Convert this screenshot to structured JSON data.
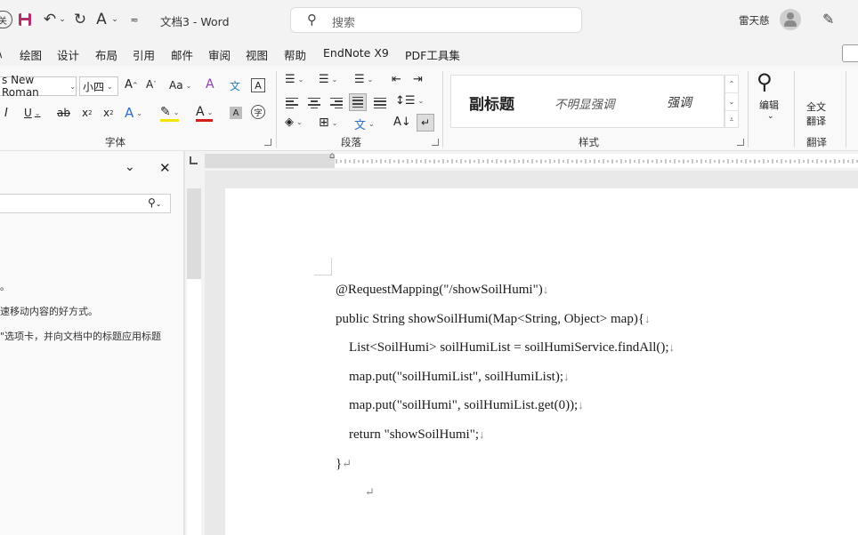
{
  "titlebar": {
    "doc_title": "文档3  -  Word",
    "search_placeholder": "搜索",
    "user_name": "雷天慈"
  },
  "menu": {
    "items": [
      "\\",
      "绘图",
      "设计",
      "布局",
      "引用",
      "邮件",
      "审阅",
      "视图",
      "帮助",
      "EndNote X9",
      "PDF工具集"
    ]
  },
  "ribbon": {
    "font_name": "s New Roman",
    "font_size": "小四",
    "groups": {
      "font": "字体",
      "paragraph": "段落",
      "styles": "样式",
      "translate": "翻译"
    },
    "styles": [
      "副标题",
      "不明显强调",
      "强调"
    ],
    "editing_label": "编辑",
    "fulltext_translate_line1": "全文",
    "fulltext_translate_line2": "翻译"
  },
  "nav_pane": {
    "line1": "。",
    "line2": "速移动内容的好方式。",
    "line3": "\"选项卡，并向文档中的标题应用标题"
  },
  "document": {
    "lines": [
      {
        "text": "@RequestMapping(\"/showSoilHumi\")",
        "mark": "↓"
      },
      {
        "text": "public String showSoilHumi(Map<String, Object> map){",
        "mark": "↓"
      },
      {
        "text": "    List<SoilHumi> soilHumiList = soilHumiService.findAll();",
        "mark": "↓"
      },
      {
        "text": "    map.put(\"soilHumiList\", soilHumiList);",
        "mark": "↓"
      },
      {
        "text": "    map.put(\"soilHumi\", soilHumiList.get(0));",
        "mark": "↓"
      },
      {
        "text": "    return \"showSoilHumi\";",
        "mark": "↓"
      },
      {
        "text": "}",
        "mark": "↵"
      },
      {
        "text": "",
        "mark": "↵"
      }
    ]
  },
  "icons": {
    "save": "save-icon",
    "undo": "undo-icon",
    "redo": "redo-icon"
  }
}
